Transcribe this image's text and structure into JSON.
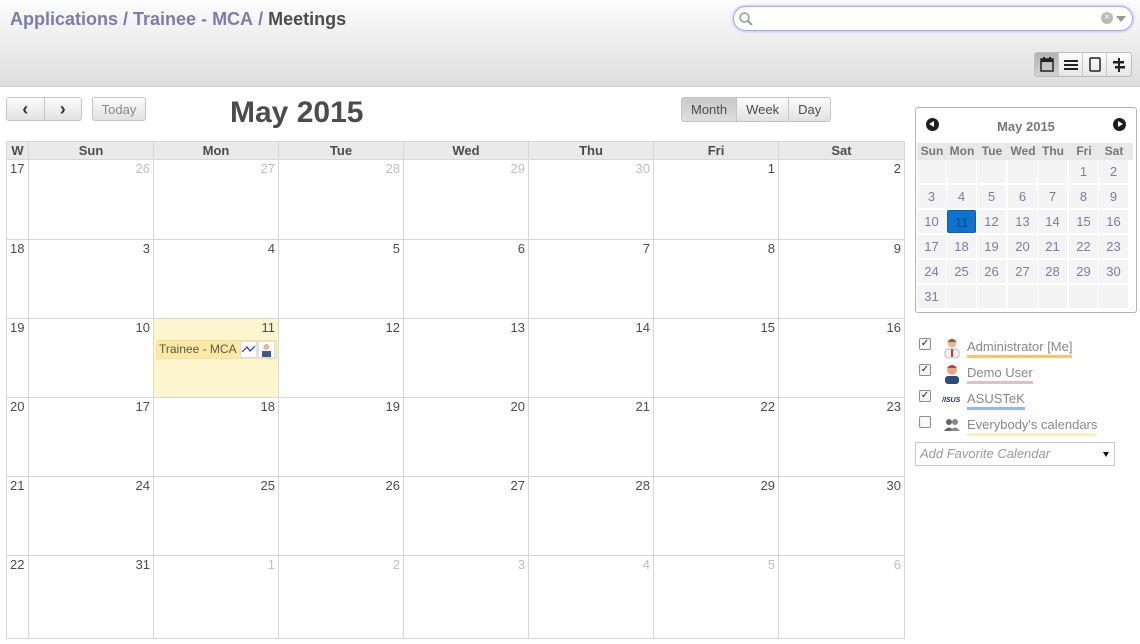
{
  "breadcrumb": {
    "items": [
      "Applications",
      "Trainee - MCA"
    ],
    "current": "Meetings",
    "separator": "/"
  },
  "search": {
    "value": "",
    "placeholder": ""
  },
  "view_switcher": [
    "calendar-icon",
    "list-icon",
    "form-icon",
    "gantt-icon"
  ],
  "toolbar": {
    "prev": "‹",
    "next": "›",
    "today": "Today",
    "title": "May 2015",
    "modes": [
      "Month",
      "Week",
      "Day"
    ],
    "active_mode": "Month"
  },
  "calendar": {
    "headers": [
      "W",
      "Sun",
      "Mon",
      "Tue",
      "Wed",
      "Thu",
      "Fri",
      "Sat"
    ],
    "weeks": [
      {
        "w": "17",
        "days": [
          "26",
          "27",
          "28",
          "29",
          "30",
          "1",
          "2"
        ]
      },
      {
        "w": "18",
        "days": [
          "3",
          "4",
          "5",
          "6",
          "7",
          "8",
          "9"
        ]
      },
      {
        "w": "19",
        "days": [
          "10",
          "11",
          "12",
          "13",
          "14",
          "15",
          "16"
        ]
      },
      {
        "w": "20",
        "days": [
          "17",
          "18",
          "19",
          "20",
          "21",
          "22",
          "23"
        ]
      },
      {
        "w": "21",
        "days": [
          "24",
          "25",
          "26",
          "27",
          "28",
          "29",
          "30"
        ]
      },
      {
        "w": "22",
        "days": [
          "31",
          "1",
          "2",
          "3",
          "4",
          "5",
          "6"
        ]
      }
    ],
    "event": {
      "title": "Trainee - MCA",
      "day": "11"
    }
  },
  "mini_calendar": {
    "title": "May 2015",
    "days": [
      "Sun",
      "Mon",
      "Tue",
      "Wed",
      "Thu",
      "Fri",
      "Sat"
    ],
    "weeks": [
      [
        "",
        "",
        "",
        "",
        "",
        "1",
        "2"
      ],
      [
        "3",
        "4",
        "5",
        "6",
        "7",
        "8",
        "9"
      ],
      [
        "10",
        "11",
        "12",
        "13",
        "14",
        "15",
        "16"
      ],
      [
        "17",
        "18",
        "19",
        "20",
        "21",
        "22",
        "23"
      ],
      [
        "24",
        "25",
        "26",
        "27",
        "28",
        "29",
        "30"
      ],
      [
        "31",
        "",
        "",
        "",
        "",
        "",
        ""
      ]
    ],
    "selected": "11"
  },
  "attendees": [
    {
      "name": "Administrator [Me]",
      "checked": true,
      "color": "#fcc36b",
      "icon": "admin-avatar-icon"
    },
    {
      "name": "Demo User",
      "checked": true,
      "color": "#e3bec9",
      "icon": "demo-user-avatar-icon"
    },
    {
      "name": "ASUSTeK",
      "checked": true,
      "color": "#94b7ed",
      "icon": "asus-logo-icon"
    },
    {
      "name": "Everybody's calendars",
      "checked": false,
      "color": "#fbf0b7",
      "icon": "users-group-icon"
    }
  ],
  "favorite": {
    "placeholder": "Add Favorite Calendar"
  }
}
